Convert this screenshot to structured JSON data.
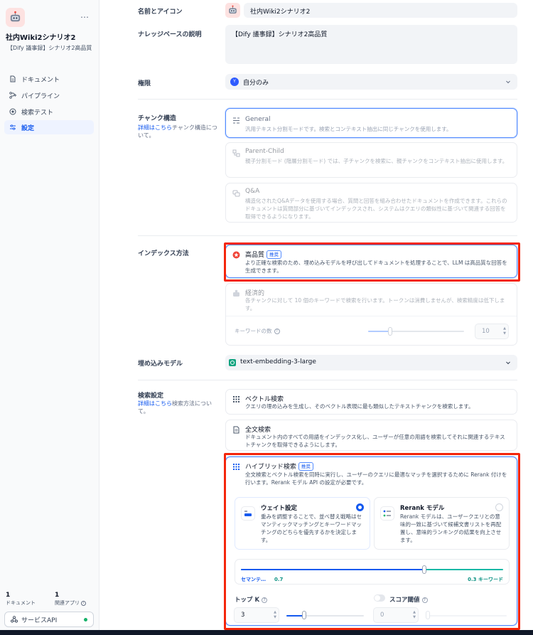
{
  "sidebar": {
    "kb_name": "社内Wiki2シナリオ2",
    "kb_description": "【Dify 議事録】シナリオ2高品質",
    "more_icon": "…",
    "nav": [
      {
        "label": "ドキュメント",
        "icon": "document-icon"
      },
      {
        "label": "パイプライン",
        "icon": "pipeline-icon"
      },
      {
        "label": "検索テスト",
        "icon": "target-icon"
      },
      {
        "label": "設定",
        "icon": "settings-icon",
        "active": true
      }
    ],
    "stats": [
      {
        "value": "1",
        "label": "ドキュメント"
      },
      {
        "value": "1",
        "label": "関連アプリ"
      }
    ],
    "service_api": {
      "label": "サービスAPI",
      "status_color": "#17b26a"
    }
  },
  "form": {
    "name_icon": {
      "label": "名前とアイコン",
      "value": "社内Wiki2シナリオ2"
    },
    "description": {
      "label": "ナレッジベースの説明",
      "value": "【Dify 議事録】シナリオ2高品質"
    },
    "permission": {
      "label": "権限",
      "value": "自分のみ",
      "avatar_letter": "Y"
    },
    "chunk": {
      "label": "チャンク構造",
      "link": "詳細はこちら",
      "suffix": "チャンク構造について。",
      "options": [
        {
          "title": "General",
          "desc": "汎用テキスト分割モードです。検索とコンテキスト抽出に同じチャンクを使用します。",
          "selected": true
        },
        {
          "title": "Parent-Child",
          "desc": "親子分割モード (階層分割モード) では、子チャンクを検索に、親チャンクをコンテキスト抽出に使用します。"
        },
        {
          "title": "Q&A",
          "desc": "構造化されたQ&Aデータを使用する場合、質問と回答を組み合わせたドキュメントを作成できます。これらのドキュメントは質問部分に基づいてインデックスされ、システムはクエリの類似性に基づいて関連する回答を取得できるようになります。"
        }
      ]
    },
    "index": {
      "label": "インデックス方法",
      "high_quality": {
        "title": "高品質",
        "badge": "推奨",
        "desc": "より正確な検索のため、埋め込みモデルを呼び出してドキュメントを処理することで、LLM は高品質な回答を生成できます。"
      },
      "economy": {
        "title": "経済的",
        "desc": "各チャンクに対して 10 個のキーワードで検索を行います。トークンは消費しませんが、検索精度は低下します。",
        "keyword_label": "キーワードの数",
        "keyword_value": "10"
      }
    },
    "embedding": {
      "label": "埋め込みモデル",
      "value": "text-embedding-3-large"
    },
    "retrieval": {
      "label": "検索設定",
      "link": "詳細はこちら",
      "suffix": "検索方法について。",
      "vector": {
        "title": "ベクトル検索",
        "desc": "クエリの埋め込みを生成し、そのベクトル表現に最も類似したテキストチャンクを検索します。"
      },
      "fulltext": {
        "title": "全文検索",
        "desc": "ドキュメント内のすべての用語をインデックス化し、ユーザーが任意の用語を検索してそれに関連するテキストチャンクを取得できるようにします。"
      },
      "hybrid": {
        "title": "ハイブリッド検索",
        "badge": "推奨",
        "desc": "全文検索とベクトル検索を同時に実行し、ユーザーのクエリに最適なマッチを選択するために Rerank 付けを行います。Rerank モデル API の設定が必要です。",
        "weight": {
          "title": "ウェイト設定",
          "desc": "重みを調整することで、並べ替え戦略はセマンティックマッチングとキーワードマッチングのどちらを優先するかを決定します。",
          "selected": true
        },
        "rerank": {
          "title": "Rerank モデル",
          "desc": "Rerank モデルは、ユーザークエリとの意味的一致に基づいて候補文書リストを再配置し、意味的ランキングの結果を向上させます。",
          "selected": false
        },
        "semantic_label": "セマンテ…",
        "semantic_value": 0.7,
        "semantic_text": "0.7",
        "keyword_text": "0.3 キーワード"
      },
      "top_k": {
        "label": "トップ K",
        "value": "3"
      },
      "score": {
        "label": "スコア閾値",
        "value": "0",
        "enabled": false
      }
    }
  }
}
